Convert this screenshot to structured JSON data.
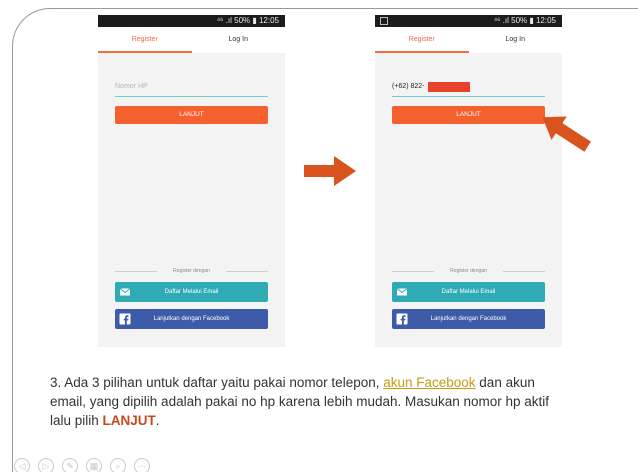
{
  "left_phone": {
    "status": "⁴⁶ .ıl 50% ▮ 12:05",
    "tab_register": "Register",
    "tab_login": "Log In",
    "input_placeholder": "Nomor HP",
    "btn_continue": "LANJUT",
    "divider_text": "Register dengan",
    "btn_email": "Daftar Melalui Email",
    "btn_facebook": "Lanjutkan dengan Facebook"
  },
  "right_phone": {
    "status": "⁴⁶ .ıl 50% ▮ 12:05",
    "tab_register": "Register",
    "tab_login": "Log In",
    "input_value": "(+62) 822-",
    "btn_continue": "LANJUT",
    "divider_text": "Register dengan",
    "btn_email": "Daftar Melalui Email",
    "btn_facebook": "Lanjutkan dengan Facebook"
  },
  "caption": {
    "part1": "3. Ada 3 pilihan untuk daftar yaitu pakai nomor telepon, ",
    "link": "akun Facebook",
    "part2": " dan akun email, yang dipilih adalah pakai no hp karena lebih mudah. Masukan nomor hp aktif lalu pilih ",
    "bold": "LANJUT",
    "part3": "."
  },
  "colors": {
    "accent_orange": "#f4612f",
    "email_teal": "#2eabb4",
    "facebook_blue": "#3d5ba9",
    "arrow_orange": "#d9531e"
  },
  "icons": {
    "email": "envelope-icon",
    "facebook": "facebook-icon",
    "toolbar": [
      "previous-icon",
      "play-icon",
      "pen-icon",
      "slides-icon",
      "zoom-icon",
      "more-icon"
    ]
  }
}
